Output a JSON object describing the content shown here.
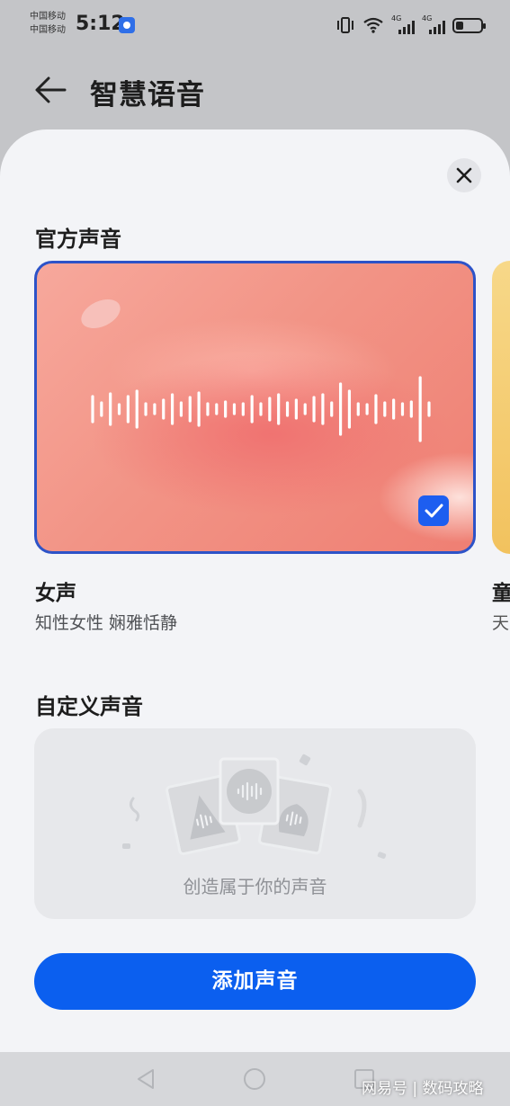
{
  "status_bar": {
    "carrier_1": "中国移动",
    "carrier_2": "中国移动",
    "time": "5:12",
    "network_1": "4G",
    "network_2": "4G"
  },
  "header": {
    "title": "智慧语音",
    "back_icon": "arrow-left-icon"
  },
  "sheet": {
    "close_icon": "close-icon",
    "official_section_title": "官方声音",
    "voices": [
      {
        "name": "女声",
        "description": "知性女性 娴雅恬静",
        "selected": true,
        "card_color": "#f29486"
      },
      {
        "name": "童",
        "description": "天",
        "selected": false,
        "card_color": "#f7d889"
      }
    ],
    "custom_section_title": "自定义声音",
    "custom_caption": "创造属于你的声音",
    "add_button_label": "添加声音"
  },
  "colors": {
    "accent": "#0b5fef",
    "selection_border": "#2d53c8",
    "sheet_background": "#f3f4f7"
  },
  "nav_bar": {
    "back_icon": "triangle-back-icon",
    "home_icon": "circle-home-icon",
    "recents_icon": "square-recents-icon"
  },
  "watermark": "网易号 | 数码攻略"
}
